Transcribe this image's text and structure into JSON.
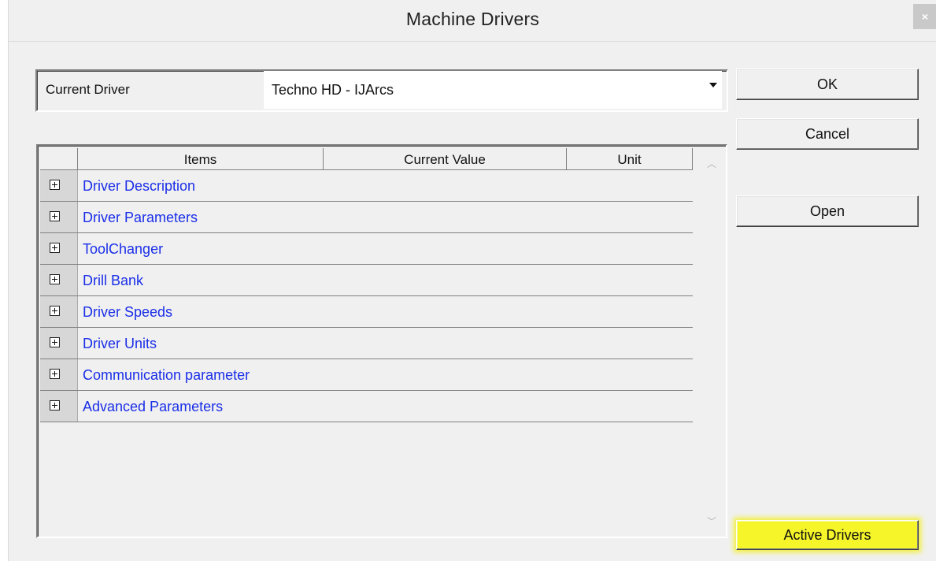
{
  "window": {
    "title": "Machine Drivers",
    "close_glyph": "×"
  },
  "driver": {
    "label": "Current Driver",
    "value": "Techno HD  -  IJArcs"
  },
  "grid": {
    "headers": {
      "items": "Items",
      "value": "Current Value",
      "unit": "Unit"
    },
    "rows": [
      {
        "label": "Driver Description"
      },
      {
        "label": "Driver Parameters"
      },
      {
        "label": "ToolChanger"
      },
      {
        "label": "Drill Bank"
      },
      {
        "label": "Driver Speeds"
      },
      {
        "label": "Driver Units"
      },
      {
        "label": "Communication parameter"
      },
      {
        "label": "Advanced Parameters"
      }
    ]
  },
  "buttons": {
    "ok": "OK",
    "cancel": "Cancel",
    "open": "Open",
    "active_drivers": "Active Drivers"
  },
  "colors": {
    "row_text": "#1a2ee8",
    "highlight": "#f5f52a"
  },
  "icons": {
    "expander": "plus-box-icon",
    "scroll_up": "chevron-up-icon",
    "scroll_down": "chevron-down-icon"
  }
}
